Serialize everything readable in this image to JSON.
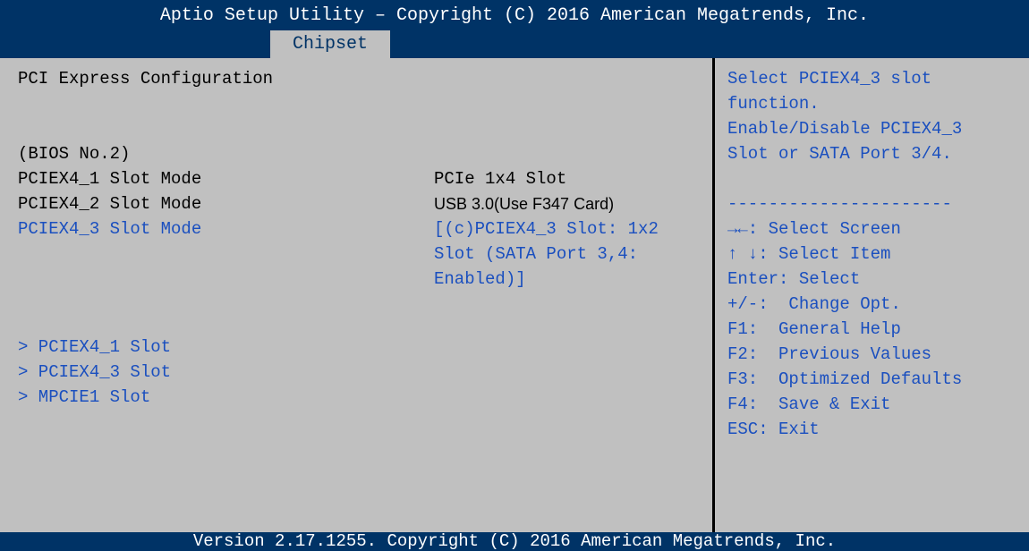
{
  "header": {
    "title": "Aptio Setup Utility – Copyright (C) 2016 American Megatrends, Inc.",
    "tabs": [
      {
        "label": "Chipset",
        "active": true
      }
    ]
  },
  "main": {
    "section_title": "PCI Express Configuration",
    "bios_no": "(BIOS No.2)",
    "settings": [
      {
        "label": "PCIEX4_1 Slot Mode",
        "value": "PCIe 1x4 Slot",
        "selectable": false
      },
      {
        "label": "PCIEX4_2 Slot Mode",
        "value": "USB 3.0(Use F347 Card)",
        "selectable": false
      },
      {
        "label": "PCIEX4_3 Slot Mode",
        "value_lines": [
          "[(c)PCIEX4_3 Slot: 1x2",
          "Slot (SATA Port 3,4:",
          "Enabled)]"
        ],
        "selectable": true
      }
    ],
    "submenus": [
      {
        "label": "> PCIEX4_1 Slot"
      },
      {
        "label": "> PCIEX4_3 Slot"
      },
      {
        "label": "> MPCIE1 Slot"
      }
    ]
  },
  "help": {
    "description_lines": [
      "Select PCIEX4_3 slot",
      "function.",
      "Enable/Disable PCIEX4_3",
      "Slot or SATA Port 3/4."
    ],
    "separator": "----------------------",
    "keys": [
      {
        "key": "→←:",
        "desc": "Select Screen"
      },
      {
        "key": "↑ ↓:",
        "desc": "Select Item"
      },
      {
        "key": "Enter:",
        "desc": "Select"
      },
      {
        "key": "+/-:",
        "desc": "Change Opt."
      },
      {
        "key": "F1:",
        "desc": "General Help"
      },
      {
        "key": "F2:",
        "desc": "Previous Values"
      },
      {
        "key": "F3:",
        "desc": "Optimized Defaults"
      },
      {
        "key": "F4:",
        "desc": "Save & Exit"
      },
      {
        "key": "ESC:",
        "desc": "Exit"
      }
    ]
  },
  "footer": {
    "version": "Version 2.17.1255. Copyright (C) 2016 American Megatrends, Inc."
  },
  "colors": {
    "header_bg": "#003366",
    "panel_bg": "#c0c0c0",
    "highlight_text": "#1a4fbf",
    "header_text": "#ffffff"
  }
}
